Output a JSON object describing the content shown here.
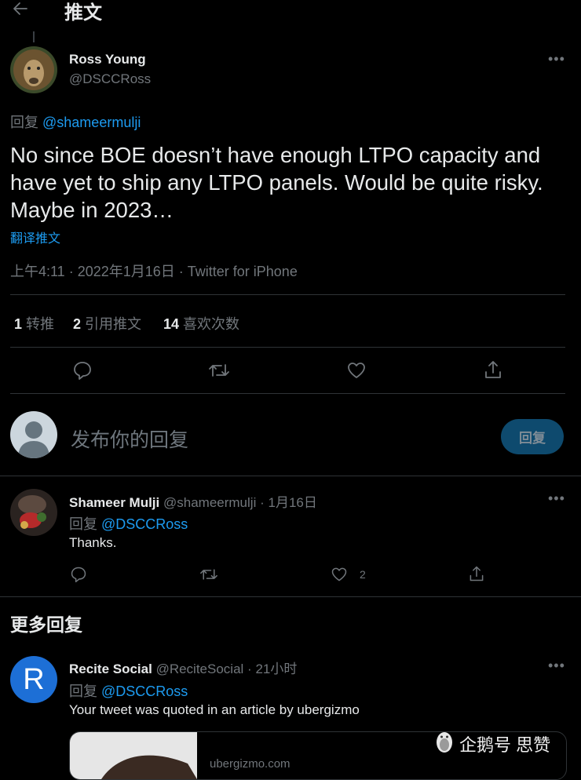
{
  "header": {
    "title": "推文"
  },
  "tweet": {
    "author_name": "Ross Young",
    "author_handle": "@DSCCRoss",
    "reply_prefix": "回复",
    "reply_to": "@shameermulji",
    "text": "No since BOE doesn’t have enough LTPO capacity and have yet to ship any LTPO panels. Would be quite risky. Maybe in 2023…",
    "translate_label": "翻译推文",
    "meta": "上午4:11 · 2022年1月16日 · Twitter for iPhone",
    "stats": {
      "retweets_count": "1",
      "retweets_label": "转推",
      "quotes_count": "2",
      "quotes_label": "引用推文",
      "likes_count": "14",
      "likes_label": "喜欢次数"
    }
  },
  "compose": {
    "placeholder": "发布你的回复",
    "button_label": "回复"
  },
  "replies": [
    {
      "author_name": "Shameer Mulji",
      "author_handle": "@shameermulji",
      "separator": "·",
      "time": "1月16日",
      "reply_prefix": "回复",
      "reply_to": "@DSCCRoss",
      "text": "Thanks.",
      "like_count": "2"
    }
  ],
  "more_replies": {
    "heading": "更多回复",
    "items": [
      {
        "avatar_letter": "R",
        "author_name": "Recite Social",
        "author_handle": "@ReciteSocial",
        "separator": "·",
        "time": "21小时",
        "reply_prefix": "回复",
        "reply_to": "@DSCCRoss",
        "text": "Your tweet was quoted in an article by ubergizmo",
        "card_domain": "ubergizmo.com"
      }
    ]
  },
  "watermark": {
    "text": "企鹅号 思赞"
  },
  "colors": {
    "background": "#000000",
    "accent": "#1d9bf0",
    "muted": "#71767b"
  },
  "icons": [
    "back-arrow-icon",
    "more-icon",
    "reply-icon",
    "retweet-icon",
    "like-icon",
    "share-icon",
    "user-silhouette-icon",
    "penguin-icon"
  ]
}
